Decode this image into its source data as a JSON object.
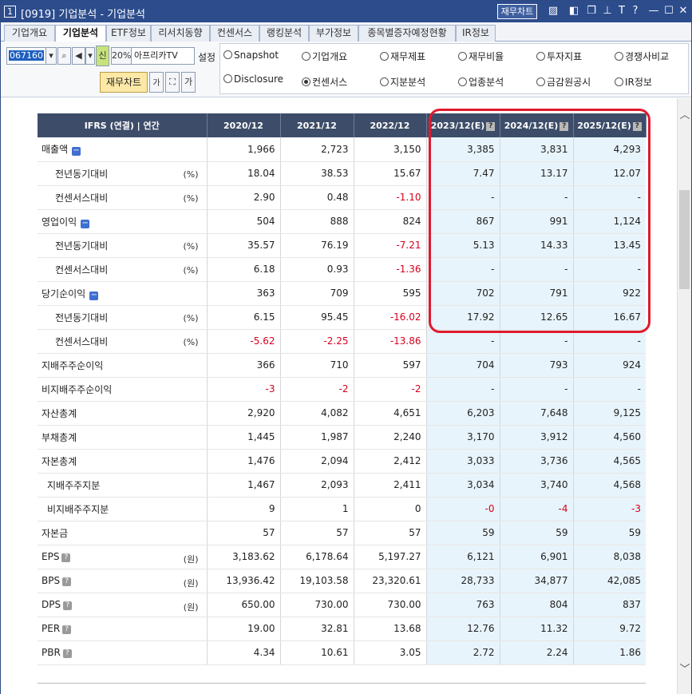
{
  "window": {
    "number": "1",
    "title": "[0919] 기업분석 - 기업분석",
    "fin_chart_button": "재무차트",
    "icons": [
      "chart-icon",
      "layout-icon",
      "copy-icon",
      "pin-icon",
      "font-icon",
      "help-icon",
      "minimize-icon",
      "maximize-icon",
      "close-icon"
    ]
  },
  "tabs": [
    {
      "label": "기업개요",
      "active": false
    },
    {
      "label": "기업분석",
      "active": true
    },
    {
      "label": "ETF정보",
      "active": false
    },
    {
      "label": "리서치동향",
      "active": false
    },
    {
      "label": "컨센서스",
      "active": false
    },
    {
      "label": "랭킹분석",
      "active": false
    },
    {
      "label": "부가정보",
      "active": false
    },
    {
      "label": "종목별증자예정현황",
      "active": false
    },
    {
      "label": "IR정보",
      "active": false
    }
  ],
  "toolbar": {
    "code": "067160",
    "percent": "20%",
    "new_badge": "신",
    "company_name": "아프리카TV",
    "setting_label": "설정",
    "fin_chart_button": "재무차트",
    "font_up": "가",
    "font_down": "가"
  },
  "radios": [
    {
      "label": "Snapshot",
      "checked": false
    },
    {
      "label": "기업개요",
      "checked": false
    },
    {
      "label": "재무제표",
      "checked": false
    },
    {
      "label": "재무비율",
      "checked": false
    },
    {
      "label": "투자지표",
      "checked": false
    },
    {
      "label": "경쟁사비교",
      "checked": false
    },
    {
      "label": "Disclosure",
      "checked": false
    },
    {
      "label": "컨센서스",
      "checked": true
    },
    {
      "label": "지분분석",
      "checked": false
    },
    {
      "label": "업종분석",
      "checked": false
    },
    {
      "label": "금감원공시",
      "checked": false
    },
    {
      "label": "IR정보",
      "checked": false
    }
  ],
  "table": {
    "header_label": "IFRS (연결) | 연간",
    "columns": [
      "2020/12",
      "2021/12",
      "2022/12",
      "2023/12(E)",
      "2024/12(E)",
      "2025/12(E)"
    ],
    "help_mark": "?",
    "rows": [
      {
        "label": "매출액",
        "unit": "",
        "indent": 0,
        "collapse": true,
        "help": false,
        "values": [
          "1,966",
          "2,723",
          "3,150",
          "3,385",
          "3,831",
          "4,293"
        ]
      },
      {
        "label": "전년동기대비",
        "unit": "(%)",
        "indent": 1,
        "collapse": false,
        "help": false,
        "values": [
          "18.04",
          "38.53",
          "15.67",
          "7.47",
          "13.17",
          "12.07"
        ]
      },
      {
        "label": "컨센서스대비",
        "unit": "(%)",
        "indent": 1,
        "collapse": false,
        "help": false,
        "values": [
          "2.90",
          "0.48",
          "-1.10",
          "-",
          "-",
          "-"
        ]
      },
      {
        "label": "영업이익",
        "unit": "",
        "indent": 0,
        "collapse": true,
        "help": false,
        "values": [
          "504",
          "888",
          "824",
          "867",
          "991",
          "1,124"
        ]
      },
      {
        "label": "전년동기대비",
        "unit": "(%)",
        "indent": 1,
        "collapse": false,
        "help": false,
        "values": [
          "35.57",
          "76.19",
          "-7.21",
          "5.13",
          "14.33",
          "13.45"
        ]
      },
      {
        "label": "컨센서스대비",
        "unit": "(%)",
        "indent": 1,
        "collapse": false,
        "help": false,
        "values": [
          "6.18",
          "0.93",
          "-1.36",
          "-",
          "-",
          "-"
        ]
      },
      {
        "label": "당기순이익",
        "unit": "",
        "indent": 0,
        "collapse": true,
        "help": false,
        "values": [
          "363",
          "709",
          "595",
          "702",
          "791",
          "922"
        ]
      },
      {
        "label": "전년동기대비",
        "unit": "(%)",
        "indent": 1,
        "collapse": false,
        "help": false,
        "values": [
          "6.15",
          "95.45",
          "-16.02",
          "17.92",
          "12.65",
          "16.67"
        ]
      },
      {
        "label": "컨센서스대비",
        "unit": "(%)",
        "indent": 1,
        "collapse": false,
        "help": false,
        "values": [
          "-5.62",
          "-2.25",
          "-13.86",
          "-",
          "-",
          "-"
        ]
      },
      {
        "label": "지배주주순이익",
        "unit": "",
        "indent": 0,
        "collapse": false,
        "help": false,
        "values": [
          "366",
          "710",
          "597",
          "704",
          "793",
          "924"
        ]
      },
      {
        "label": "비지배주주순이익",
        "unit": "",
        "indent": 0,
        "collapse": false,
        "help": false,
        "values": [
          "-3",
          "-2",
          "-2",
          "-",
          "-",
          "-"
        ]
      },
      {
        "label": "자산총계",
        "unit": "",
        "indent": 0,
        "collapse": false,
        "help": false,
        "values": [
          "2,920",
          "4,082",
          "4,651",
          "6,203",
          "7,648",
          "9,125"
        ]
      },
      {
        "label": "부채총계",
        "unit": "",
        "indent": 0,
        "collapse": false,
        "help": false,
        "values": [
          "1,445",
          "1,987",
          "2,240",
          "3,170",
          "3,912",
          "4,560"
        ]
      },
      {
        "label": "자본총계",
        "unit": "",
        "indent": 0,
        "collapse": false,
        "help": false,
        "values": [
          "1,476",
          "2,094",
          "2,412",
          "3,033",
          "3,736",
          "4,565"
        ]
      },
      {
        "label": "지배주주지분",
        "unit": "",
        "indent": 2,
        "collapse": false,
        "help": false,
        "values": [
          "1,467",
          "2,093",
          "2,411",
          "3,034",
          "3,740",
          "4,568"
        ]
      },
      {
        "label": "비지배주주지분",
        "unit": "",
        "indent": 2,
        "collapse": false,
        "help": false,
        "values": [
          "9",
          "1",
          "0",
          "-0",
          "-4",
          "-3"
        ]
      },
      {
        "label": "자본금",
        "unit": "",
        "indent": 0,
        "collapse": false,
        "help": false,
        "values": [
          "57",
          "57",
          "57",
          "59",
          "59",
          "59"
        ]
      },
      {
        "label": "EPS",
        "unit": "(원)",
        "indent": 0,
        "collapse": false,
        "help": true,
        "values": [
          "3,183.62",
          "6,178.64",
          "5,197.27",
          "6,121",
          "6,901",
          "8,038"
        ]
      },
      {
        "label": "BPS",
        "unit": "(원)",
        "indent": 0,
        "collapse": false,
        "help": true,
        "values": [
          "13,936.42",
          "19,103.58",
          "23,320.61",
          "28,733",
          "34,877",
          "42,085"
        ]
      },
      {
        "label": "DPS",
        "unit": "(원)",
        "indent": 0,
        "collapse": false,
        "help": true,
        "values": [
          "650.00",
          "730.00",
          "730.00",
          "763",
          "804",
          "837"
        ]
      },
      {
        "label": "PER",
        "unit": "",
        "indent": 0,
        "collapse": false,
        "help": true,
        "values": [
          "19.00",
          "32.81",
          "13.68",
          "12.76",
          "11.32",
          "9.72"
        ]
      },
      {
        "label": "PBR",
        "unit": "",
        "indent": 0,
        "collapse": false,
        "help": true,
        "values": [
          "4.34",
          "10.61",
          "3.05",
          "2.72",
          "2.24",
          "1.86"
        ]
      }
    ]
  },
  "colors": {
    "title_bar": "#2c4c8c",
    "table_header": "#3d4d69",
    "estimate_bg": "#e8f4fb",
    "negative": "#d6001c",
    "highlight_border": "#e01a2e"
  }
}
